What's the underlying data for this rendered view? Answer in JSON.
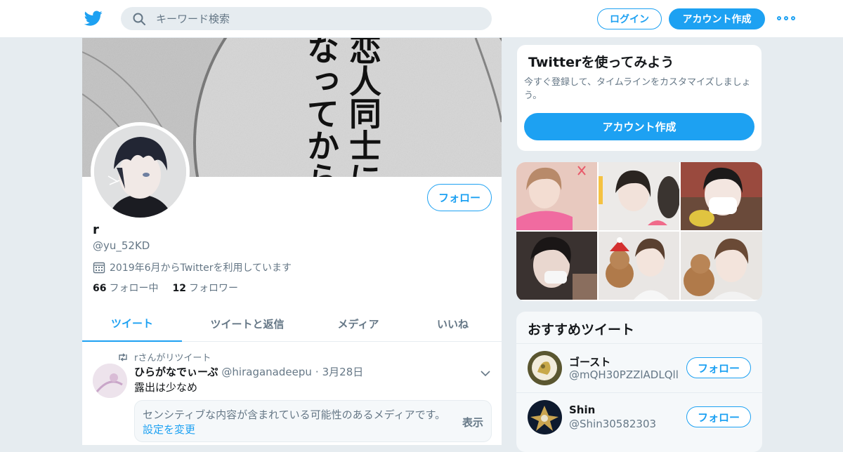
{
  "header": {
    "logo_icon": "twitter-bird-icon",
    "search_placeholder": "キーワード検索",
    "login_label": "ログイン",
    "signup_label": "アカウント作成",
    "more_icon": "more-dots-icon",
    "accent_color": "#1da1f2"
  },
  "banner": {
    "text_lines": [
      "恋人同士に",
      "なってから"
    ]
  },
  "profile": {
    "name": "r",
    "handle": "@yu_52KD",
    "joined": "2019年6月からTwitterを利用しています",
    "follow_label": "フォロー",
    "following_count": "66",
    "following_label": "フォロー中",
    "followers_count": "12",
    "followers_label": "フォロワー"
  },
  "tabs": [
    {
      "label": "ツイート",
      "active": true
    },
    {
      "label": "ツイートと返信",
      "active": false
    },
    {
      "label": "メディア",
      "active": false
    },
    {
      "label": "いいね",
      "active": false
    }
  ],
  "tweet": {
    "retweet_text": "rさんがリツイート",
    "author_name": "ひらがなでぃーぷ",
    "author_handle": "@hiraganadeepu",
    "dot": "·",
    "date": "3月28日",
    "text": "露出は少なめ",
    "sensitive_text": "センシティブな内容が含まれている可能性のあるメディアです。",
    "sensitive_link": "設定を変更",
    "show_label": "表示"
  },
  "signup_card": {
    "title": "Twitterを使ってみよう",
    "description": "今すぐ登録して、タイムラインをカスタマイズしましょう。",
    "button": "アカウント作成"
  },
  "who_to_follow": {
    "title": "おすすめツイート",
    "users": [
      {
        "name": "ゴースト",
        "handle": "@mQH30PZZlADLQll",
        "follow_label": "フォロー"
      },
      {
        "name": "Shin",
        "handle": "@Shin30582303",
        "follow_label": "フォロー"
      }
    ]
  }
}
